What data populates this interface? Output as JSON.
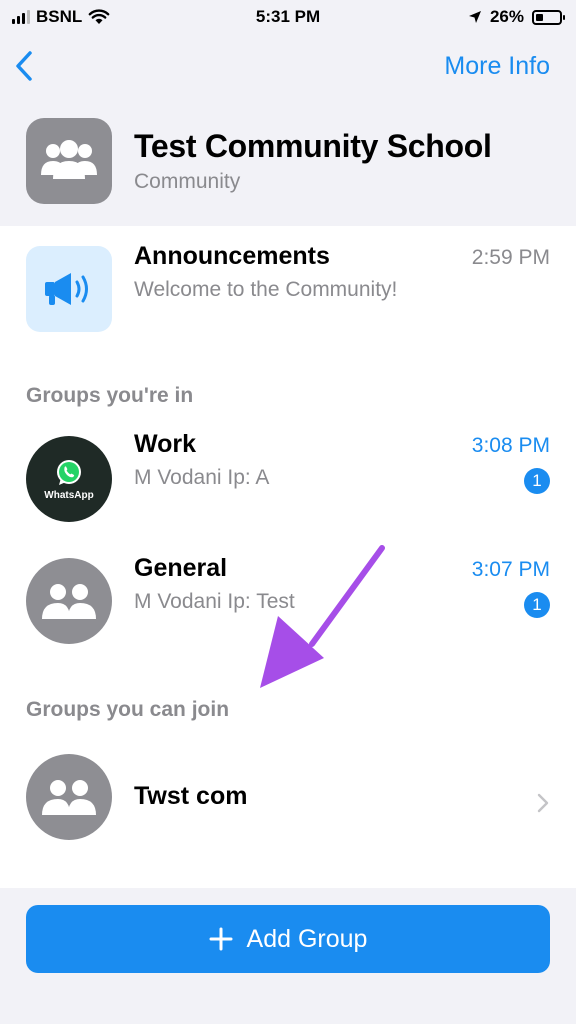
{
  "status_bar": {
    "carrier": "BSNL",
    "time": "5:31 PM",
    "battery_percent": "26%",
    "battery_level": 0.26,
    "icons": [
      "signal-icon",
      "wifi-icon",
      "location-icon",
      "battery-icon"
    ]
  },
  "nav": {
    "back_icon": "chevron-left-icon",
    "more_info_label": "More Info"
  },
  "community": {
    "name": "Test Community School",
    "subtitle": "Community",
    "icon": "group-icon"
  },
  "announcements": {
    "title": "Announcements",
    "preview": "Welcome to the Community!",
    "time": "2:59 PM",
    "icon": "megaphone-icon"
  },
  "groups_in": {
    "label": "Groups you're in",
    "items": [
      {
        "name": "Work",
        "preview": "M Vodani Ip: A",
        "time": "3:08 PM",
        "unread": "1",
        "avatar_text": "WhatsApp"
      },
      {
        "name": "General",
        "preview": "M Vodani Ip: Test",
        "time": "3:07 PM",
        "unread": "1"
      }
    ]
  },
  "groups_join": {
    "label": "Groups you can join",
    "items": [
      {
        "name": "Twst com"
      }
    ]
  },
  "footer": {
    "add_group_label": "Add Group"
  },
  "colors": {
    "accent": "#1a8cf0",
    "annotation_arrow": "#a64ee8",
    "avatar_gray": "#8e8e93",
    "background": "#f2f2f7"
  }
}
